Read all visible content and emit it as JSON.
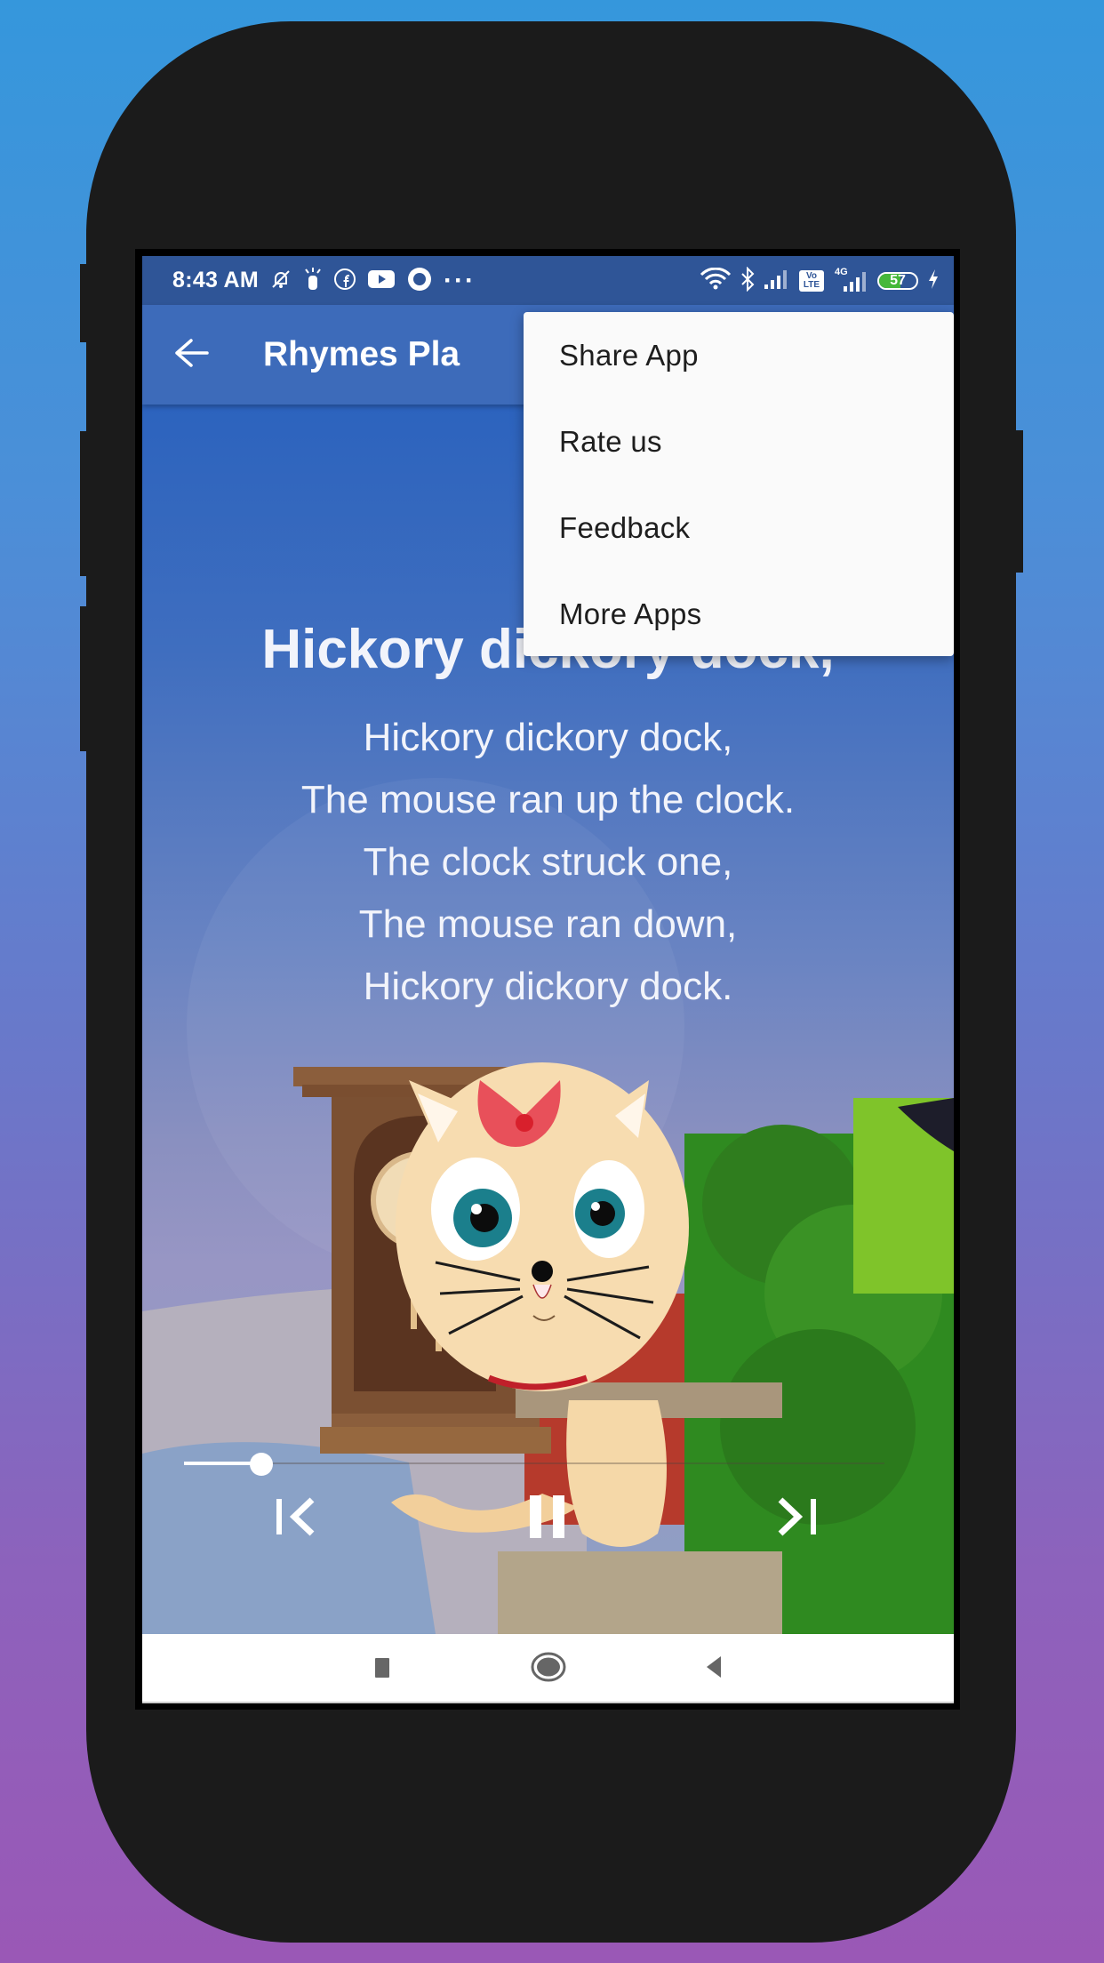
{
  "device": {
    "colors": {
      "body": "#1b1b1b",
      "background_top": "#3597dc",
      "background_bottom": "#9a58b6"
    }
  },
  "status_bar": {
    "time": "8:43 AM",
    "left_icons": [
      "mute-bell-icon",
      "flashlight-icon",
      "facebook-icon",
      "youtube-icon",
      "camera-ring-icon",
      "more-dots-icon"
    ],
    "right_icons": [
      "wifi-icon",
      "bluetooth-icon",
      "signal-icon",
      "volte-icon",
      "4g-signal-icon",
      "battery-icon",
      "charging-icon"
    ],
    "network_label": "4G",
    "volte_label": "Vo LTE",
    "battery_level": "57",
    "battery_percent": 57,
    "dots": "···",
    "color": "#2f5597"
  },
  "app_bar": {
    "title": "Rhymes Pla",
    "back_icon": "arrow-left-icon",
    "color": "#3d6bba"
  },
  "video": {
    "lyrics_title": "Hickory dickory dock,",
    "lyrics": [
      "Hickory dickory dock,",
      "The mouse ran up the clock.",
      "The clock struck one,",
      "The mouse ran down,",
      "Hickory dickory dock."
    ],
    "scene_description": "Cartoon kitten with red bow next to a grandfather clock"
  },
  "player": {
    "progress": 0.11,
    "controls": {
      "previous": "skip-previous-icon",
      "pause": "pause-icon",
      "next": "skip-next-icon"
    }
  },
  "overflow_menu": {
    "items": [
      {
        "label": "Share App"
      },
      {
        "label": "Rate us"
      },
      {
        "label": "Feedback"
      },
      {
        "label": "More Apps"
      }
    ]
  },
  "nav_bar": {
    "buttons": [
      "recents-square-icon",
      "home-circle-icon",
      "back-triangle-icon"
    ]
  }
}
